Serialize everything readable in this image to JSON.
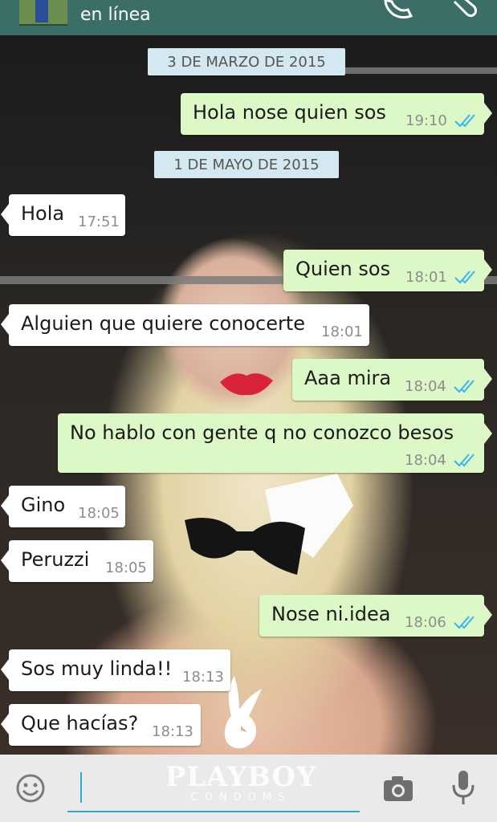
{
  "header": {
    "status": "en línea",
    "icons": [
      "phone-icon",
      "paperclip-icon"
    ]
  },
  "wallpaper": {
    "brand": "PLAYBOY",
    "sub_brand": "CONDOMS"
  },
  "chat": {
    "date_1": "3 DE MARZO DE 2015",
    "date_2": "1 DE MAYO DE 2015",
    "messages": [
      {
        "dir": "out",
        "text": "Hola nose quien sos",
        "time": "19:10",
        "read": true
      },
      {
        "dir": "in",
        "text": "Hola",
        "time": "17:51"
      },
      {
        "dir": "out",
        "text": "Quien sos",
        "time": "18:01",
        "read": true
      },
      {
        "dir": "in",
        "text": "Alguien que quiere conocerte",
        "time": "18:01"
      },
      {
        "dir": "out",
        "text": "Aaa mira",
        "time": "18:04",
        "read": true
      },
      {
        "dir": "out",
        "text": "No hablo con gente q no conozco besos",
        "time": "18:04",
        "read": true
      },
      {
        "dir": "in",
        "text": "Gino",
        "time": "18:05"
      },
      {
        "dir": "in",
        "text": "Peruzzi",
        "time": "18:05"
      },
      {
        "dir": "out",
        "text": "Nose ni.idea",
        "time": "18:06",
        "read": true
      },
      {
        "dir": "in",
        "text": "Sos muy linda!!",
        "time": "18:13"
      },
      {
        "dir": "in",
        "text": "Que hacías?",
        "time": "18:13"
      }
    ]
  },
  "input": {
    "value": "",
    "icons": [
      "emoji-icon",
      "camera-icon",
      "mic-icon"
    ]
  },
  "colors": {
    "header": "#3a6e66",
    "outgoing": "#dcf8c6",
    "incoming": "#ffffff",
    "date_chip": "#d4e8f1",
    "read_ticks": "#34b7f1",
    "accent": "#2aa9dd"
  }
}
